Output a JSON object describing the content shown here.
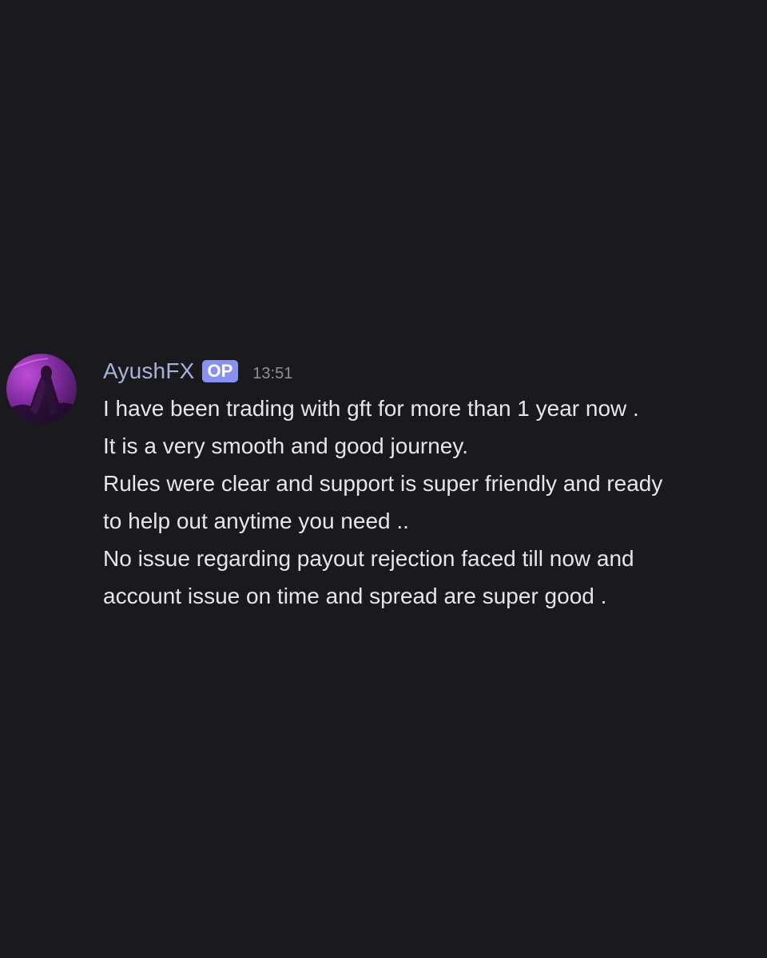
{
  "message": {
    "author": "AyushFX",
    "badge": "OP",
    "timestamp": "13:51",
    "avatar_icon": "user-avatar",
    "lines": [
      "I have been trading with gft for more than 1 year now .",
      "It is a very smooth and good journey.",
      "Rules were clear and support is super friendly and ready",
      "to help out anytime you need ..",
      "No issue regarding payout rejection faced till now and",
      "account issue on time and spread are super good ."
    ]
  },
  "colors": {
    "background": "#1a1a1e",
    "username": "#aab1d6",
    "badge": "#8891f2",
    "text": "#e5e6ea",
    "timestamp": "#8d8f99"
  }
}
